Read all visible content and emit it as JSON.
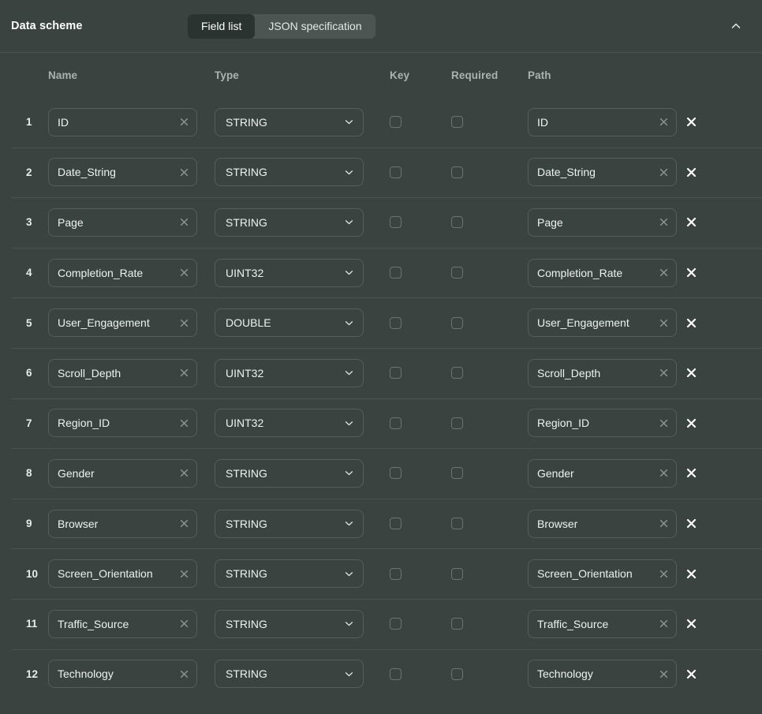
{
  "header": {
    "title": "Data scheme",
    "tabs": [
      {
        "label": "Field list",
        "active": true
      },
      {
        "label": "JSON specification",
        "active": false
      }
    ],
    "collapse_icon": "chevron-up-icon"
  },
  "table": {
    "columns": [
      "Name",
      "Type",
      "Key",
      "Required",
      "Path"
    ],
    "clear_icon": "close-icon",
    "delete_icon": "close-icon",
    "dropdown_icon": "chevron-down-icon",
    "rows": [
      {
        "num": "1",
        "name": "ID",
        "type": "STRING",
        "key": false,
        "required": false,
        "path": "ID"
      },
      {
        "num": "2",
        "name": "Date_String",
        "type": "STRING",
        "key": false,
        "required": false,
        "path": "Date_String"
      },
      {
        "num": "3",
        "name": "Page",
        "type": "STRING",
        "key": false,
        "required": false,
        "path": "Page"
      },
      {
        "num": "4",
        "name": "Completion_Rate",
        "type": "UINT32",
        "key": false,
        "required": false,
        "path": "Completion_Rate"
      },
      {
        "num": "5",
        "name": "User_Engagement",
        "type": "DOUBLE",
        "key": false,
        "required": false,
        "path": "User_Engagement"
      },
      {
        "num": "6",
        "name": "Scroll_Depth",
        "type": "UINT32",
        "key": false,
        "required": false,
        "path": "Scroll_Depth"
      },
      {
        "num": "7",
        "name": "Region_ID",
        "type": "UINT32",
        "key": false,
        "required": false,
        "path": "Region_ID"
      },
      {
        "num": "8",
        "name": "Gender",
        "type": "STRING",
        "key": false,
        "required": false,
        "path": "Gender"
      },
      {
        "num": "9",
        "name": "Browser",
        "type": "STRING",
        "key": false,
        "required": false,
        "path": "Browser"
      },
      {
        "num": "10",
        "name": "Screen_Orientation",
        "type": "STRING",
        "key": false,
        "required": false,
        "path": "Screen_Orientation"
      },
      {
        "num": "11",
        "name": "Traffic_Source",
        "type": "STRING",
        "key": false,
        "required": false,
        "path": "Traffic_Source"
      },
      {
        "num": "12",
        "name": "Technology",
        "type": "STRING",
        "key": false,
        "required": false,
        "path": "Technology"
      }
    ]
  },
  "colors": {
    "background": "#3a4340",
    "panel_border": "#4a5350",
    "field_border": "#555e5b",
    "tab_active_bg": "#2b3331",
    "segment_bg": "#4c5552",
    "text_primary": "#eef2f1",
    "text_muted": "#a9b3b0"
  }
}
